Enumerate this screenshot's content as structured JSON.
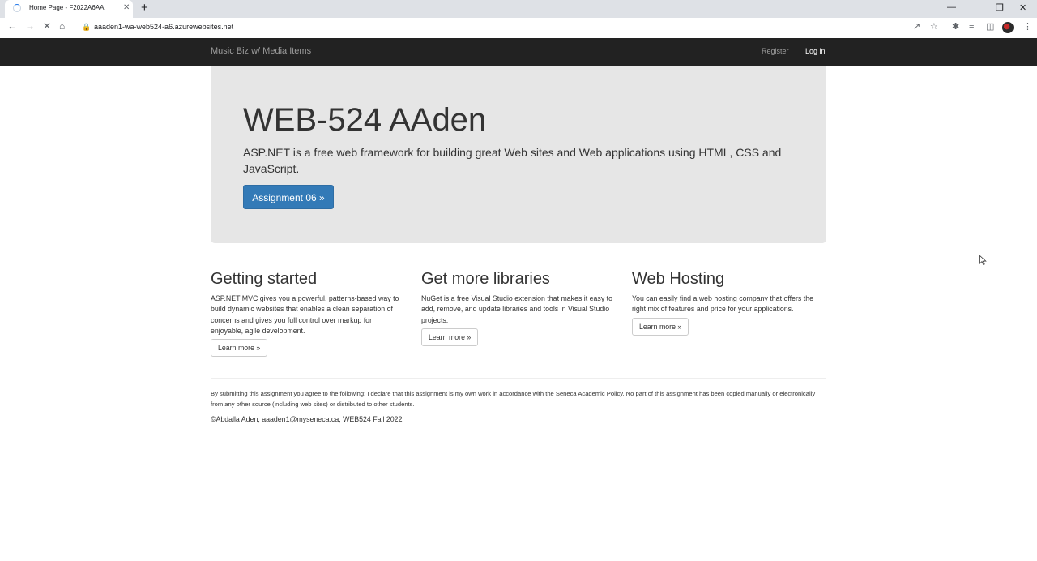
{
  "browser": {
    "tab_title": "Home Page - F2022A6AA",
    "close_tab": "✕",
    "new_tab": "+",
    "url": "aaaden1-wa-web524-a6.azurewebsites.net"
  },
  "navbar": {
    "brand": "Music Biz w/ Media Items",
    "register": "Register",
    "login": "Log in"
  },
  "jumbotron": {
    "title": "WEB-524 AAden",
    "lead": "ASP.NET is a free web framework for building great Web sites and Web applications using HTML, CSS and JavaScript.",
    "button": "Assignment 06 »"
  },
  "columns": [
    {
      "heading": "Getting started",
      "text": "ASP.NET MVC gives you a powerful, patterns-based way to build dynamic websites that enables a clean separation of concerns and gives you full control over markup for enjoyable, agile development.",
      "button": "Learn more »"
    },
    {
      "heading": "Get more libraries",
      "text": "NuGet is a free Visual Studio extension that makes it easy to add, remove, and update libraries and tools in Visual Studio projects.",
      "button": "Learn more »"
    },
    {
      "heading": "Web Hosting",
      "text": "You can easily find a web hosting company that offers the right mix of features and price for your applications.",
      "button": "Learn more »"
    }
  ],
  "footer": {
    "disclaimer": "By submitting this assignment you agree to the following: I declare that this assignment is my own work in accordance with the Seneca Academic Policy. No part of this assignment has been copied manually or electronically from any other source (including web sites) or distributed to other students.",
    "copyright": "©Abdalla Aden, aaaden1@myseneca.ca, WEB524 Fall 2022"
  },
  "icons": [
    "loading-spinner-icon",
    "back-arrow-icon",
    "forward-arrow-icon",
    "stop-loading-icon",
    "home-icon",
    "lock-icon",
    "share-icon",
    "star-icon",
    "extensions-icon",
    "reading-list-icon",
    "side-panel-icon",
    "profile-avatar",
    "menu-icon",
    "minimize-icon",
    "restore-icon",
    "close-window-icon",
    "mouse-cursor-icon"
  ],
  "colors": {
    "navbar_bg": "#222222",
    "jumbotron_bg": "#e6e6e6",
    "primary_button": "#337ab7"
  }
}
